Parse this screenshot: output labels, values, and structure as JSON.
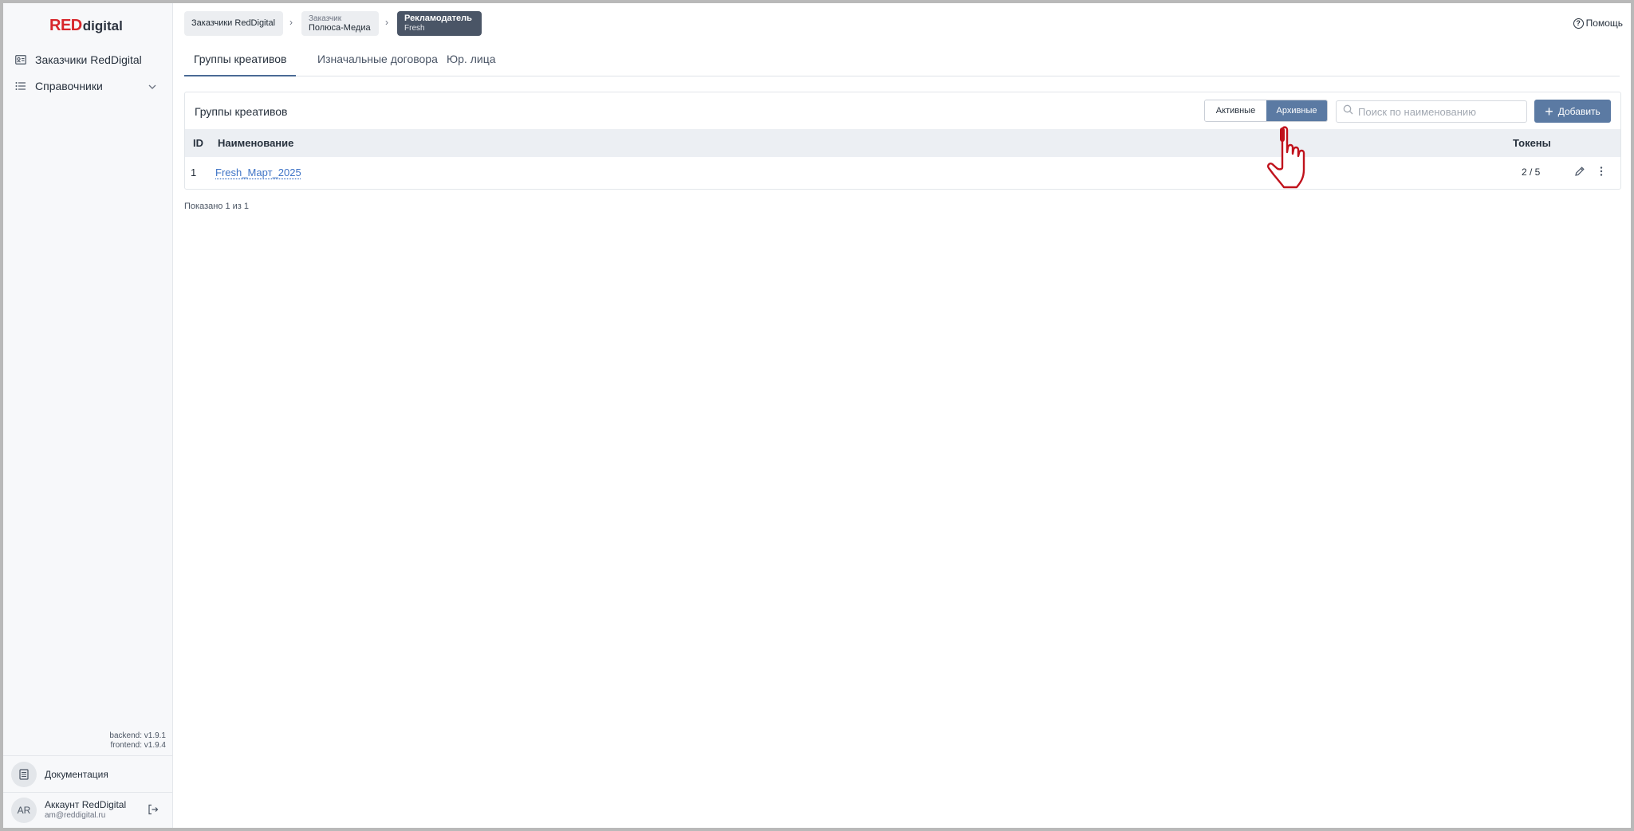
{
  "brand": {
    "red": "RED",
    "digital": "digital",
    "red_color": "#d7262b"
  },
  "sidebar": {
    "items": [
      {
        "label": "Заказчики RedDigital",
        "icon": "id-card-icon"
      },
      {
        "label": "Справочники",
        "icon": "list-icon",
        "expandable": true
      }
    ],
    "versions": {
      "backend": "backend: v1.9.1",
      "frontend": "frontend: v1.9.4"
    },
    "documentation": "Документация",
    "account": {
      "initials": "AR",
      "name": "Аккаунт RedDigital",
      "email": "am@reddigital.ru"
    }
  },
  "header": {
    "breadcrumbs": [
      {
        "small": "",
        "main": "Заказчики RedDigital"
      },
      {
        "small": "Заказчик",
        "main": "Полюса-Медиа"
      },
      {
        "small": "Рекламодатель",
        "main": "Fresh",
        "active": true
      }
    ],
    "help": "Помощь"
  },
  "tabs": [
    {
      "label": "Группы креативов",
      "active": true
    },
    {
      "label": "Изначальные договора"
    },
    {
      "label": "Юр. лица"
    }
  ],
  "card": {
    "title": "Группы креативов",
    "filter": {
      "active_label": "Активные",
      "archived_label": "Архивные",
      "selected": "Архивные"
    },
    "search_placeholder": "Поиск по наименованию",
    "add_label": "Добавить",
    "columns": {
      "id": "ID",
      "name": "Наименование",
      "tokens": "Токены"
    },
    "rows": [
      {
        "id": "1",
        "name": "Fresh_Март_2025",
        "tokens": "2 / 5"
      }
    ]
  },
  "footer": {
    "shown": "Показано 1 из 1"
  },
  "colors": {
    "accent": "#5b7aa3",
    "active_crumb": "#4a5566",
    "link": "#3f74c6"
  }
}
